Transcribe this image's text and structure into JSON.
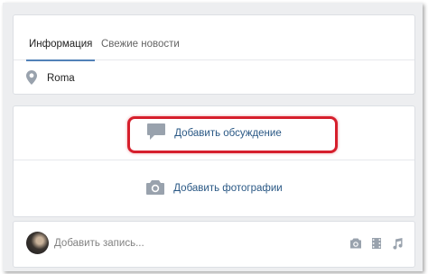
{
  "tabs": [
    {
      "label": "Информация",
      "active": true
    },
    {
      "label": "Свежие новости",
      "active": false
    }
  ],
  "info": {
    "city": "Roma",
    "icon": "location-pin-icon"
  },
  "actions": {
    "add_discussion": {
      "label": "Добавить обсуждение",
      "icon": "speech-bubble-icon"
    },
    "add_photos": {
      "label": "Добавить фотографии",
      "icon": "camera-icon"
    }
  },
  "post": {
    "placeholder": "Добавить запись...",
    "icons": [
      "camera-icon",
      "video-icon",
      "music-icon"
    ]
  },
  "colors": {
    "accent": "#5181b8",
    "icon": "#99a2ad",
    "link": "#2a5885",
    "highlight": "#d61f2c",
    "background": "#edeef0"
  }
}
